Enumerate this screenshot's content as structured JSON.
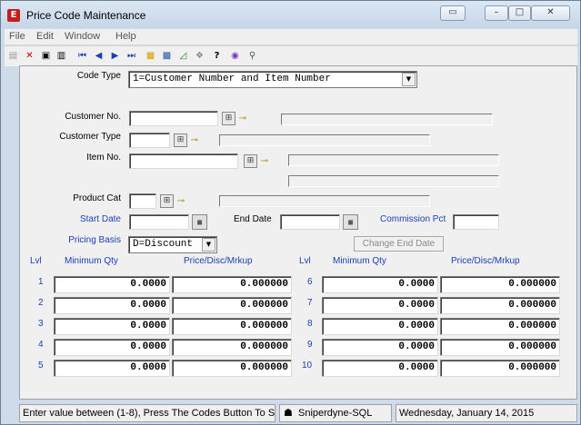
{
  "window": {
    "title": "Price Code Maintenance",
    "app_icon_letter": "E"
  },
  "menu": [
    "File",
    "Edit",
    "Window",
    "Help"
  ],
  "toolbar": {
    "icons": [
      "new-record-icon",
      "delete-icon",
      "save-icon",
      "trash-icon",
      "first-record-icon",
      "previous-record-icon",
      "next-record-icon",
      "last-record-icon",
      "notes-icon",
      "calculator-icon",
      "chart-icon",
      "network-icon",
      "help-cursor-icon",
      "image-icon",
      "search-icon"
    ]
  },
  "form": {
    "code_type": {
      "label": "Code Type",
      "value": "1=Customer Number and Item Number"
    },
    "customer_no": {
      "label": "Customer No.",
      "value": "",
      "desc": ""
    },
    "customer_type": {
      "label": "Customer Type",
      "value": "",
      "desc": ""
    },
    "item_no": {
      "label": "Item No.",
      "value": "",
      "desc1": "",
      "desc2": ""
    },
    "product_cat": {
      "label": "Product Cat",
      "value": "",
      "desc": ""
    },
    "start_date": {
      "label": "Start Date",
      "value": ""
    },
    "end_date": {
      "label": "End Date",
      "value": ""
    },
    "commission_pct": {
      "label": "Commission Pct",
      "value": ""
    },
    "pricing_basis": {
      "label": "Pricing Basis",
      "value": "D=Discount"
    },
    "change_end_date_label": "Change End Date"
  },
  "levels": {
    "headers": {
      "lvl": "Lvl",
      "min_qty": "Minimum Qty",
      "price": "Price/Disc/Mrkup"
    },
    "rows": [
      {
        "lvl": "1",
        "min_qty": "0.0000",
        "price": "0.000000"
      },
      {
        "lvl": "2",
        "min_qty": "0.0000",
        "price": "0.000000"
      },
      {
        "lvl": "3",
        "min_qty": "0.0000",
        "price": "0.000000"
      },
      {
        "lvl": "4",
        "min_qty": "0.0000",
        "price": "0.000000"
      },
      {
        "lvl": "5",
        "min_qty": "0.0000",
        "price": "0.000000"
      },
      {
        "lvl": "6",
        "min_qty": "0.0000",
        "price": "0.000000"
      },
      {
        "lvl": "7",
        "min_qty": "0.0000",
        "price": "0.000000"
      },
      {
        "lvl": "8",
        "min_qty": "0.0000",
        "price": "0.000000"
      },
      {
        "lvl": "9",
        "min_qty": "0.0000",
        "price": "0.000000"
      },
      {
        "lvl": "10",
        "min_qty": "0.0000",
        "price": "0.000000"
      }
    ]
  },
  "status": {
    "message": "Enter value between (1-8), Press The Codes Button To S",
    "company": "Sniperdyne-SQL",
    "date": "Wednesday, January 14, 2015"
  },
  "colors": {
    "accent_label": "#1a3fb5",
    "client_bg": "#f0f0f0",
    "frame": "#cfdbe8"
  }
}
